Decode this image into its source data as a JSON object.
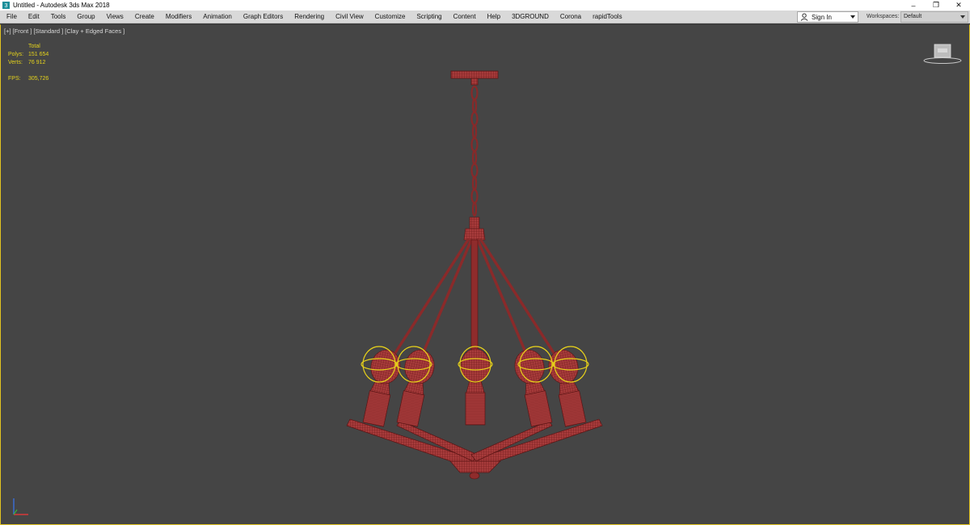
{
  "window": {
    "title": "Untitled - Autodesk 3ds Max 2018",
    "controls": {
      "minimize": "–",
      "restore": "❐",
      "close": "✕"
    }
  },
  "menubar": {
    "items": [
      {
        "label": "File"
      },
      {
        "label": "Edit"
      },
      {
        "label": "Tools"
      },
      {
        "label": "Group"
      },
      {
        "label": "Views"
      },
      {
        "label": "Create"
      },
      {
        "label": "Modifiers"
      },
      {
        "label": "Animation"
      },
      {
        "label": "Graph Editors"
      },
      {
        "label": "Rendering"
      },
      {
        "label": "Civil View"
      },
      {
        "label": "Customize"
      },
      {
        "label": "Scripting"
      },
      {
        "label": "Content"
      },
      {
        "label": "Help"
      },
      {
        "label": "3DGROUND"
      },
      {
        "label": "Corona"
      },
      {
        "label": "rapidTools"
      }
    ],
    "signin_label": "Sign In",
    "workspaces_label": "Workspaces:",
    "workspaces_value": "Default"
  },
  "viewport": {
    "label": "[+] [Front ] [Standard ] [Clay + Edged Faces ]",
    "stats": {
      "header": "Total",
      "polys_label": "Polys:",
      "polys_value": "151 654",
      "verts_label": "Verts:",
      "verts_value": "76 912",
      "fps_label": "FPS:",
      "fps_value": "305,726"
    },
    "colors": {
      "background": "#454545",
      "model": "#a23a3a",
      "wire": "#6a1616",
      "selection": "#e8d21a"
    }
  }
}
